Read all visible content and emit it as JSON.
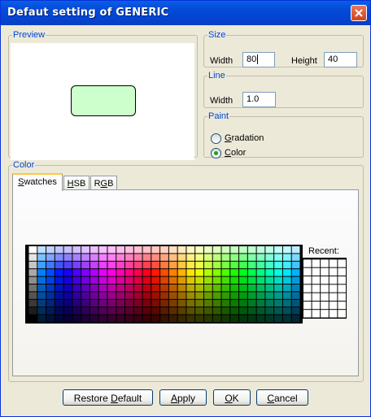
{
  "title": "Defaut setting of GENERIC",
  "preview": {
    "legend": "Preview",
    "fill_color": "#ccffcc"
  },
  "size": {
    "legend": "Size",
    "width_label": "Width",
    "width_value": "80",
    "height_label": "Height",
    "height_value": "40"
  },
  "line": {
    "legend": "Line",
    "width_label": "Width",
    "width_value": "1.0"
  },
  "paint": {
    "legend": "Paint",
    "options": [
      {
        "label": "Gradation",
        "mnemonic": "G",
        "selected": false
      },
      {
        "label": "Color",
        "mnemonic": "C",
        "selected": true
      }
    ]
  },
  "color": {
    "legend": "Color",
    "tabs": [
      {
        "label": "Swatches",
        "mnemonic": "S",
        "active": true
      },
      {
        "label": "HSB",
        "mnemonic": "H",
        "active": false
      },
      {
        "label": "RGB",
        "mnemonic": "G",
        "active": false
      }
    ],
    "recent_label": "Recent:"
  },
  "buttons": [
    {
      "label": "Restore Default",
      "mnemonic": "D"
    },
    {
      "label": "Apply",
      "mnemonic": "A"
    },
    {
      "label": "OK",
      "mnemonic": "O"
    },
    {
      "label": "Cancel",
      "mnemonic": "C"
    }
  ]
}
